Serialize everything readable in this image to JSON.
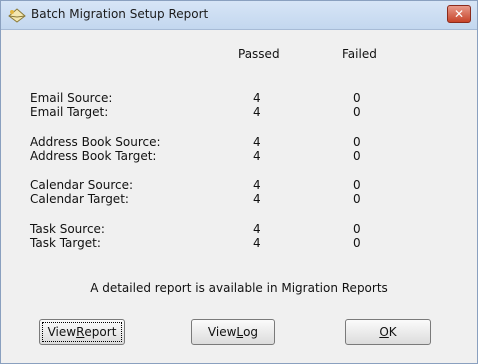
{
  "window": {
    "title": "Batch Migration Setup Report",
    "close_glyph": "✕"
  },
  "headers": {
    "passed": "Passed",
    "failed": "Failed"
  },
  "rows": [
    {
      "label": "Email Source:",
      "passed": "4",
      "failed": "0"
    },
    {
      "label": "Email Target:",
      "passed": "4",
      "failed": "0"
    },
    {
      "label": "Address Book Source:",
      "passed": "4",
      "failed": "0"
    },
    {
      "label": "Address Book Target:",
      "passed": "4",
      "failed": "0"
    },
    {
      "label": "Calendar Source:",
      "passed": "4",
      "failed": "0"
    },
    {
      "label": "Calendar Target:",
      "passed": "4",
      "failed": "0"
    },
    {
      "label": "Task Source:",
      "passed": "4",
      "failed": "0"
    },
    {
      "label": "Task Target:",
      "passed": "4",
      "failed": "0"
    }
  ],
  "note": "A detailed report is available in Migration Reports",
  "buttons": {
    "view_report_pre": "View ",
    "view_report_u": "R",
    "view_report_post": "eport",
    "view_log_pre": "View ",
    "view_log_u": "L",
    "view_log_post": "og",
    "ok_u": "O",
    "ok_post": "K"
  },
  "icons": {
    "title": "envelope-icon",
    "close": "close-icon"
  },
  "colors": {
    "close_button": "#c7442a",
    "dialog_bg": "#f0f0f0"
  }
}
